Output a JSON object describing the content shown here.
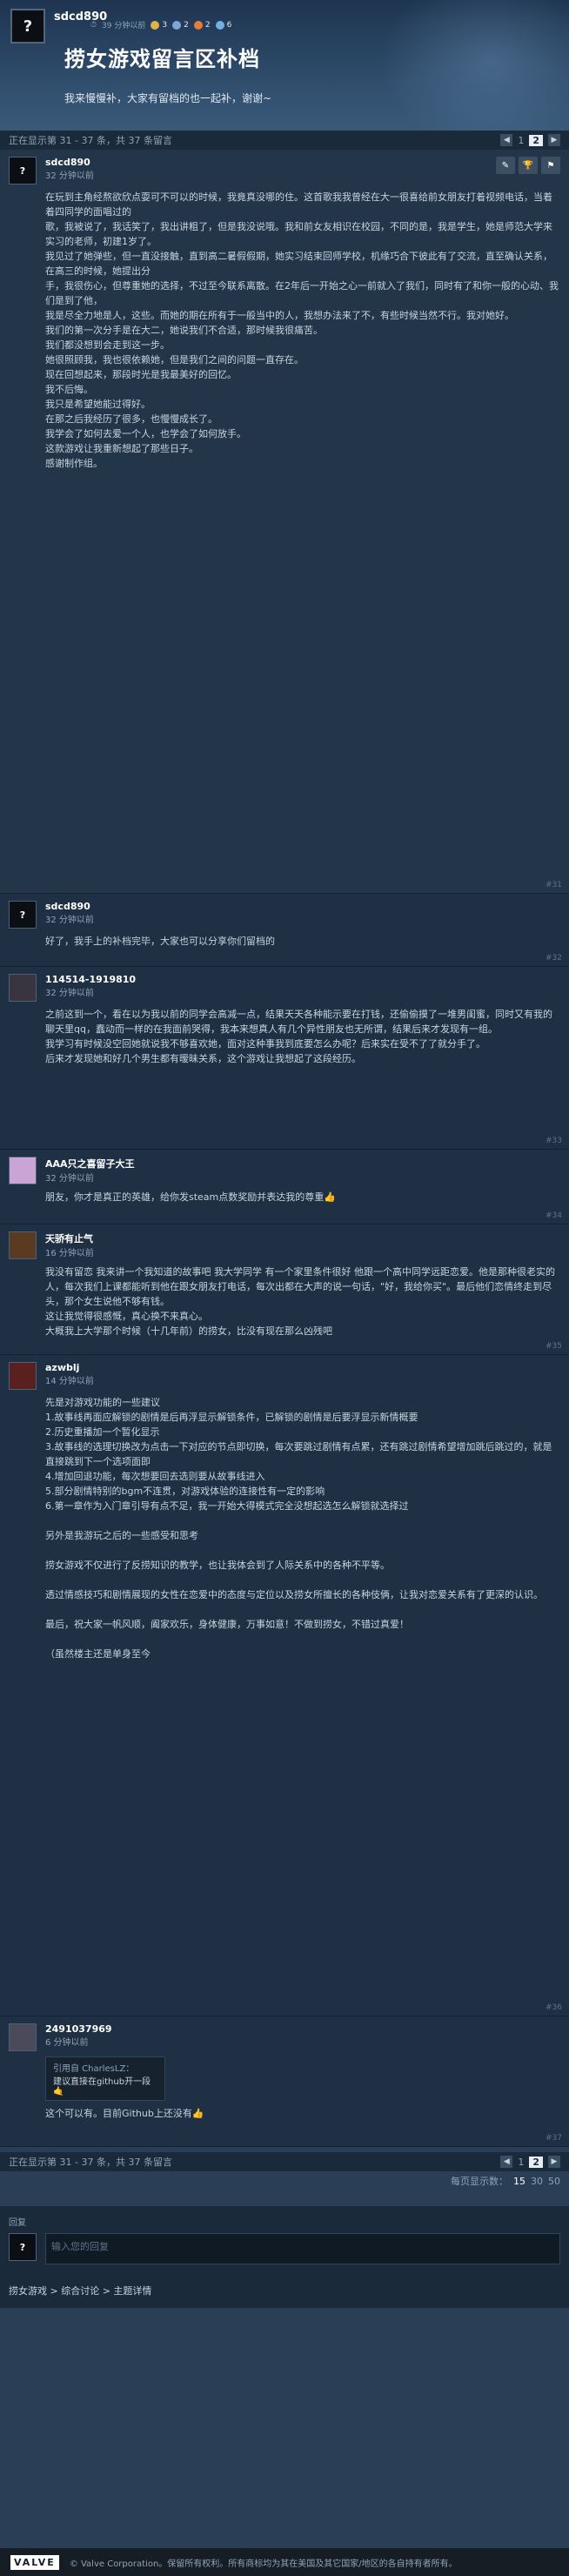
{
  "header": {
    "op_avatar": "?",
    "op_name": "sdcd890",
    "op_status": "39 分钟以前",
    "op_badges": [
      "3",
      "2",
      "2",
      "6"
    ],
    "title": "捞女游戏留言区补档",
    "subtitle": "我来慢慢补，大家有留档的也一起补，谢谢~"
  },
  "pager_top": {
    "text": "正在显示第 31 - 37 条，共 37 条留言",
    "prev": "◀",
    "pages": [
      "1",
      "2"
    ],
    "next": "▶"
  },
  "op_post": {
    "avatar": "?",
    "name": "sdcd890",
    "time": "32 分钟以前",
    "tools": [
      "✎",
      "🏆",
      "⚑"
    ],
    "body": "在玩到主角经熬欲欣点耍可不可以的时候，我竟真没哪的住。这首歌我我曾经在大一很喜给前女朋友打着视频电话，当着着四同学的面唱过的\n歌，我被说了，我话笑了，我出讲粗了，但是我没说哦。我和前女友相识在校园，不同的是，我是学生，她是师范大学来实习的老师，初建1岁了。\n我见过了她弹些，但一直没接触，直到高二暑假假期，她实习结束回师学校，机缘巧合下彼此有了交流，直至确认关系，在高三的时候，她提出分\n手，我很伤心，但尊重她的选择，不过至今联系离散。在2年后一开始之心一前就入了我们，同时有了和你一般的心动、我们是到了他，\n我是尽全力地是人，这些。而她的期在所有于一般当中的人，我想办法来了不，有些时候当然不行。我对她好。\n我们的第一次分手是在大二，她说我们不合适，那时候我很痛苦。\n我们都没想到会走到这一步。\n她很照顾我，我也很依赖她，但是我们之间的问题一直存在。\n现在回想起来，那段时光是我最美好的回忆。\n我不后悔。\n我只是希望她能过得好。\n在那之后我经历了很多，也慢慢成长了。\n我学会了如何去爱一个人，也学会了如何放手。\n这款游戏让我重新想起了那些日子。\n感谢制作组。",
    "num": "#31"
  },
  "posts": [
    {
      "avatar": "?",
      "name": "sdcd890",
      "time": "32 分钟以前",
      "body": "好了，我手上的补档完毕，大家也可以分享你们留档的",
      "num": "#32",
      "avcolor": "#0b0f14"
    },
    {
      "avatar": "",
      "name": "114514-1919810",
      "time": "32 分钟以前",
      "body": "之前这到一个，看在以为我以前的同学会高减一点，结果天天各种能示要在打钱，还偷偷摸了一堆男闺蜜，同时又有我的聊天里qq，蠢动而一样的在我面前哭得，我本来想真人有几个异性朋友也无所谓，结果后来才发现有一组。\n我学习有时候没空回她就说我不够喜欢她，面对这种事我到底要怎么办呢？后来实在受不了了就分手了。\n后来才发现她和好几个男生都有暧昧关系，这个游戏让我想起了这段经历。",
      "num": "#33",
      "avcolor": "#3a3340"
    },
    {
      "avatar": "",
      "name": "AAA只之喜留子大王",
      "time": "32 分钟以前",
      "body": "朋友，你才是真正的英雄，给你发steam点数奖励并表达我的尊重👍",
      "num": "#34",
      "avcolor": "#c9a4d4"
    },
    {
      "avatar": "",
      "name": "天骄有止气",
      "time": "16 分钟以前",
      "body": "我没有留恋 我来讲一个我知道的故事吧 我大学同学 有一个家里条件很好 他跟一个高中同学远距恋爱。他是那种很老实的人，每次我们上课都能听到他在跟女朋友打电话，每次出都在大声的说一句话，\"好，我给你买\"。最后他们恋情终走到尽头，那个女生说他不够有钱。\n这让我觉得很感慨，真心换不来真心。\n大概我上大学那个时候（十几年前）的捞女，比没有现在那么凶残吧",
      "num": "#35",
      "avcolor": "#5a3a20"
    },
    {
      "avatar": "",
      "name": "azwblj",
      "time": "14 分钟以前",
      "body": "先是对游戏功能的一些建议\n1.故事线再面应解锁的剧情是后再浮显示解锁条件，已解锁的剧情是后要浮显示新情概要\n2.历史重播加一个暂化显示\n3.故事线的选理切换改为点击一下对应的节点即切换，每次要跳过剧情有点累，还有跳过剧情希望增加跳后跳过的，就是直接跳到下一个选项面即\n4.增加回退功能，每次想要回去选则要从故事线进入\n5.部分剧情特别的bgm不连贯，对游戏体验的连接性有一定的影响\n6.第一章作为入门章引导有点不足，我一开始大得模式完全没想起选怎么解锁就选择过\n\n另外是我游玩之后的一些感受和思考\n\n捞女游戏不仅进行了反捞知识的教学，也让我体会到了人际关系中的各种不平等。\n\n透过情感技巧和剧情展现的女性在恋爱中的态度与定位以及捞女所擅长的各种伎俩，让我对恋爱关系有了更深的认识。\n\n最后，祝大家一帆风顺，阖家欢乐，身体健康，万事如意！不做到捞女，不错过真爱！\n\n（虽然楼主还是单身至今",
      "num": "#36",
      "avcolor": "#5a2020"
    },
    {
      "avatar": "",
      "name": "2491037969",
      "time": "6 分钟以前",
      "quote_head": "引用自 CharlesLZ：",
      "quote_body": "建议直接在github开一段🤙",
      "body": "这个可以有。目前Github上还没有👍",
      "num": "#37",
      "avcolor": "#4a4a5a"
    }
  ],
  "pager_bottom": {
    "text": "正在显示第 31 - 37 条，共 37 条留言",
    "prev": "◀",
    "pages": [
      "1",
      "2"
    ],
    "next": "▶",
    "per_page_label": "每页显示数：",
    "per_page": [
      "15",
      "30",
      "50"
    ]
  },
  "reply": {
    "label": "回复",
    "avatar": "?",
    "placeholder": "输入您的回复"
  },
  "breadcrumb": "捞女游戏 > 综合讨论 > 主题详情",
  "footer": {
    "logo": "VALVE",
    "text": "© Valve Corporation。保留所有权利。所有商标均为其在美国及其它国家/地区的各自持有者所有。"
  }
}
